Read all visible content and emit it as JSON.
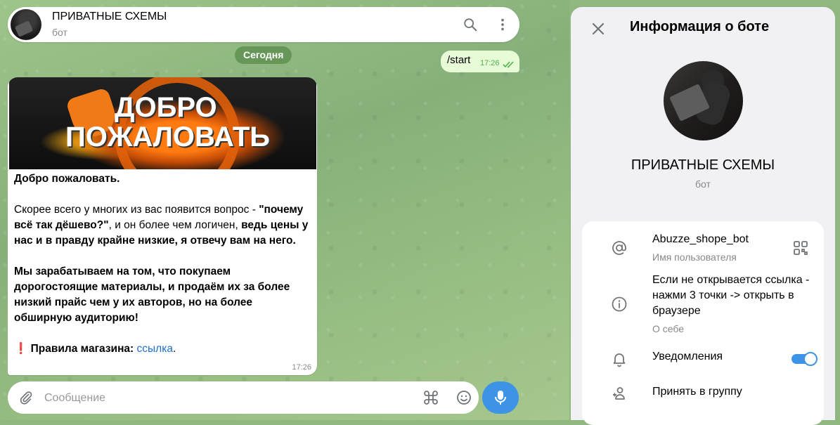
{
  "chat": {
    "title": "ПРИВАТНЫЕ СХЕМЫ",
    "subtitle": "бот",
    "date_label": "Сегодня",
    "outgoing": {
      "text": "/start",
      "time": "17:26"
    },
    "incoming": {
      "banner_line1": "ДОБРО",
      "banner_line2": "ПОЖАЛОВАТЬ",
      "heading": "Добро пожаловать.",
      "p2_start": "Скорее всего у многих из вас появится вопрос - ",
      "p2_bold": "\"почему всё так дёшево?\"",
      "p2_mid": ", и он более чем логичен, ",
      "p2_bold2": "ведь цены у нас и в правду крайне низкие, я отвечу вам на него.",
      "p3": "Мы зарабатываем на том, что покупаем дорогостоящие материалы, и продаём их за более низкий прайс чем у их авторов, но на более обширную аудиторию!",
      "rules_emoji": "❗",
      "rules_label": "Правила магазина:",
      "rules_link": "ссылка",
      "rules_end": ".",
      "time": "17:26"
    },
    "composer_placeholder": "Сообщение"
  },
  "panel": {
    "title": "Информация о боте",
    "name": "ПРИВАТНЫЕ СХЕМЫ",
    "type": "бот",
    "username": "Abuzze_shope_bot",
    "username_label": "Имя пользователя",
    "bio": "Если не открывается ссылка - нажми 3 точки -> открыть в браузере",
    "bio_label": "О себе",
    "notifications": "Уведомления",
    "notifications_on": true,
    "add_to_group": "Принять в группу"
  },
  "colors": {
    "accent": "#3d94e6",
    "outgoing_bubble": "#e7fbd7",
    "link": "#1e6fd0"
  }
}
